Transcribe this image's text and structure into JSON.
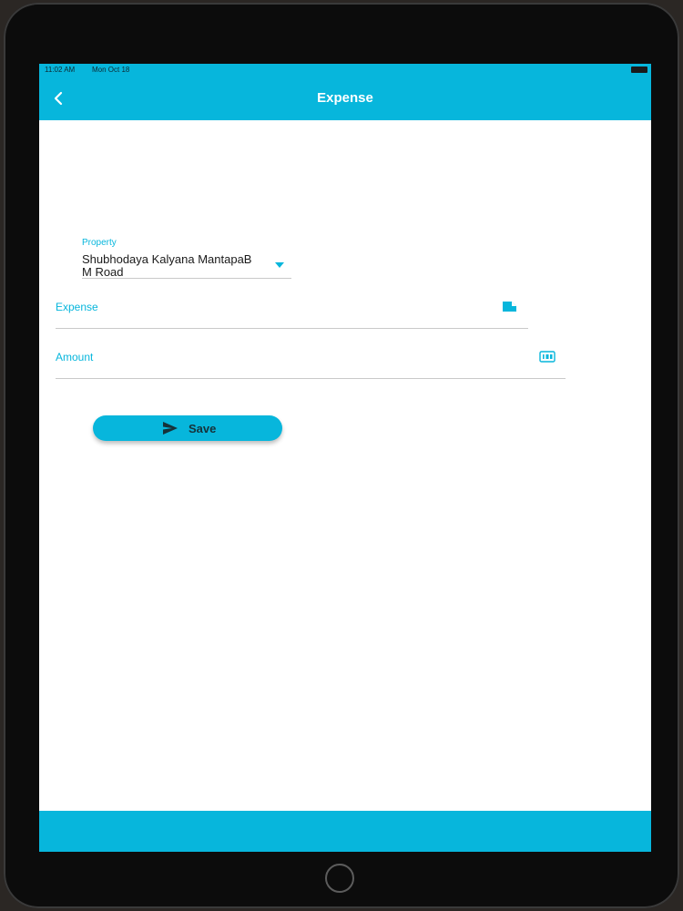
{
  "status_bar": {
    "time": "11:02 AM",
    "date": "Mon Oct 18"
  },
  "header": {
    "title": "Expense",
    "back_icon": "chevron-left-icon"
  },
  "form": {
    "property": {
      "label": "Property",
      "value": "Shubhodaya Kalyana MantapaB M Road"
    },
    "expense": {
      "label": "Expense",
      "value": "",
      "icon": "note-icon"
    },
    "amount": {
      "label": "Amount",
      "value": "",
      "icon": "numeric-keypad-icon"
    },
    "save": {
      "label": "Save",
      "icon": "send-icon"
    }
  },
  "colors": {
    "accent": "#07b6dc",
    "background": "#ffffff",
    "divider": "#c9c9c9",
    "text": "#1a1a1a"
  }
}
